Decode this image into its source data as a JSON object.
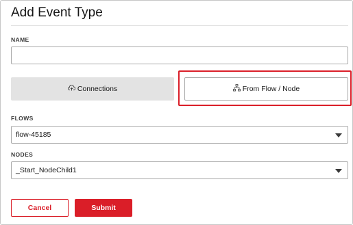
{
  "dialog": {
    "title": "Add Event Type"
  },
  "name_field": {
    "label": "NAME",
    "value": ""
  },
  "source_toggle": {
    "options": [
      {
        "label": "Connections",
        "icon": "cloud-upload-icon",
        "selected": false
      },
      {
        "label": "From Flow / Node",
        "icon": "hierarchy-icon",
        "selected": true
      }
    ]
  },
  "flows": {
    "label": "FLOWS",
    "selected": "flow-45185"
  },
  "nodes": {
    "label": "NODES",
    "selected": "_Start_NodeChild1"
  },
  "actions": {
    "cancel_label": "Cancel",
    "submit_label": "Submit"
  },
  "colors": {
    "accent": "#da1e28",
    "inactive_segment": "#e3e3e3"
  }
}
